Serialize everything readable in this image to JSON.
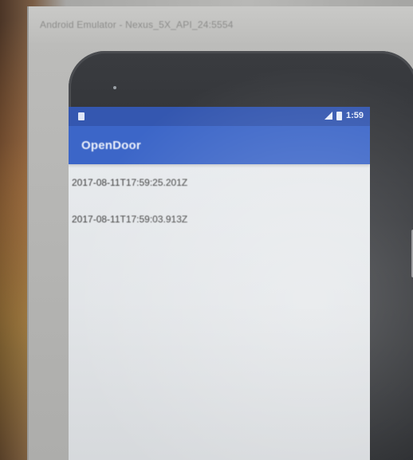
{
  "emulator": {
    "title": "Android Emulator - Nexus_5X_API_24:5554"
  },
  "status_bar": {
    "time": "1:59"
  },
  "app_bar": {
    "title": "OpenDoor"
  },
  "list": {
    "items": [
      "2017-08-11T17:59:25.201Z",
      "2017-08-11T17:59:03.913Z"
    ]
  },
  "colors": {
    "status_bar": "#3457b0",
    "app_bar": "#3c66c8",
    "screen_background": "#e6e9ec"
  }
}
